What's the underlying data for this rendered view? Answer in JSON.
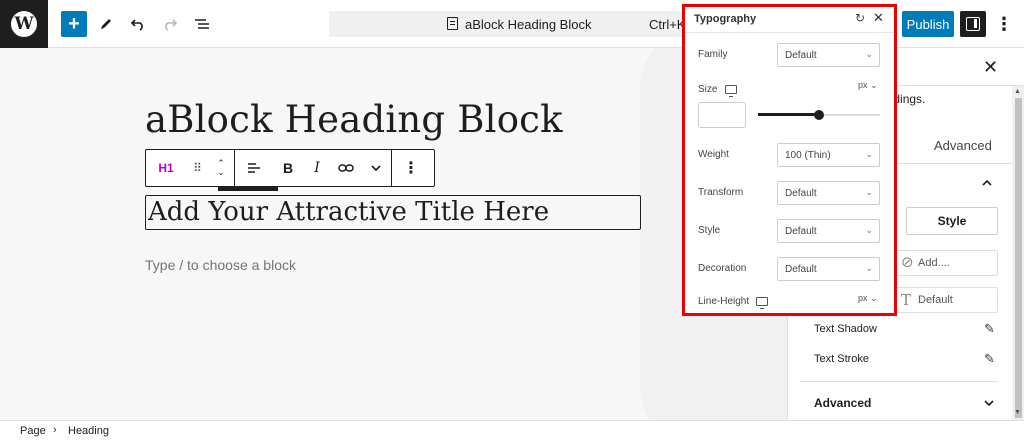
{
  "topbar": {
    "logo_glyph": "W",
    "add_glyph": "+",
    "doc_title": "aBlock Heading Block",
    "doc_shortcut": "Ctrl+K",
    "publish_label": "Publish",
    "more_glyph": "⋮",
    "icons": [
      "wordpress-logo",
      "add-block",
      "edit-tools",
      "undo",
      "redo",
      "document-overview",
      "settings-toggle",
      "options"
    ]
  },
  "canvas": {
    "heading": "aBlock Heading Block",
    "title_field_value": "Add Your Attractive Title Here",
    "placeholder": "Type / to choose a block"
  },
  "block_toolbar": {
    "level": "H1",
    "drag_glyph": "⠿",
    "up_glyph": "⌃",
    "down_glyph": "⌄",
    "align_glyph": "≡",
    "bold_glyph": "B",
    "italic_glyph": "I",
    "link_glyph": "⊖",
    "more_chev_glyph": "⌄",
    "options_glyph": "⋮"
  },
  "typography": {
    "title": "Typography",
    "family": {
      "label": "Family",
      "value": "Default"
    },
    "size": {
      "label": "Size",
      "unit": "px",
      "value": "",
      "slider_fraction": 0.5
    },
    "weight": {
      "label": "Weight",
      "value": "100 (Thin)"
    },
    "transform": {
      "label": "Transform",
      "value": "Default"
    },
    "style": {
      "label": "Style",
      "value": "Default"
    },
    "decoration": {
      "label": "Decoration",
      "value": "Default"
    },
    "line_height": {
      "label": "Line-Height",
      "unit": "px"
    }
  },
  "sidebar": {
    "desc_fragment": "eadings.",
    "tab_advanced": "Advanced",
    "style_button": "Style",
    "add_placeholder": "Add....",
    "font_default": "Default",
    "text_shadow": "Text Shadow",
    "text_stroke": "Text Stroke",
    "advanced_section": "Advanced"
  },
  "statusbar": {
    "crumbs": [
      "Page",
      "Heading"
    ]
  },
  "colors": {
    "accent": "#007cba",
    "highlight_border": "#e00000",
    "heading_level": "#c400bd"
  }
}
